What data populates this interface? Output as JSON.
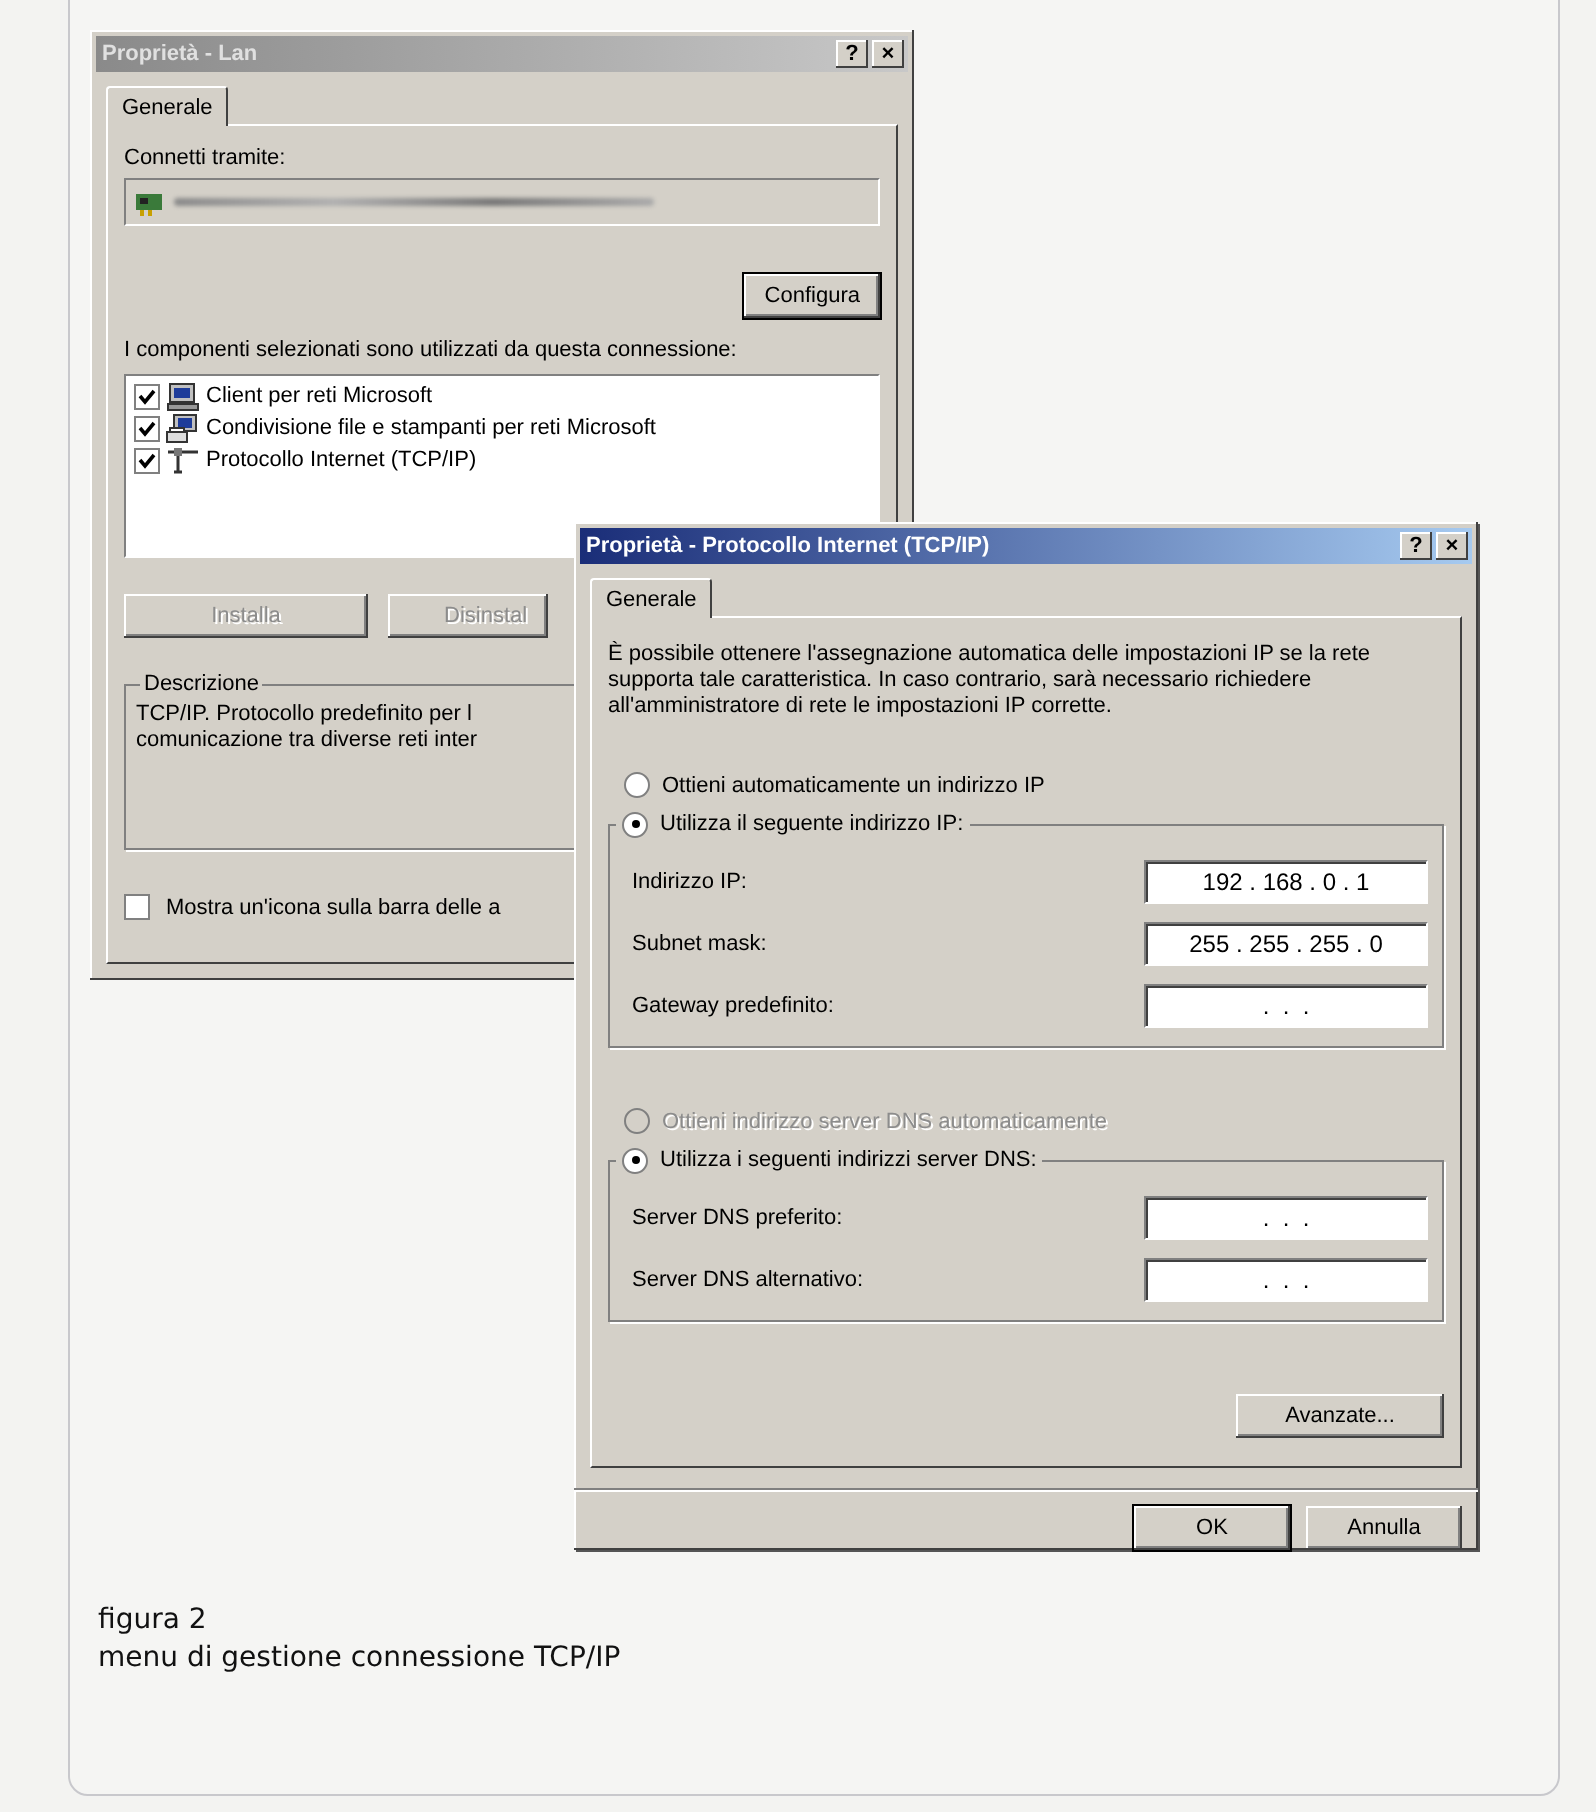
{
  "lan_dialog": {
    "title": "Proprietà - Lan",
    "active": false,
    "help_button": "?",
    "close_button": "×",
    "tabs": [
      {
        "label": "Generale",
        "selected": true
      }
    ],
    "connect_label": "Connetti tramite:",
    "configure_button": "Configura",
    "components_label": "I componenti selezionati sono utilizzati da questa connessione:",
    "components": [
      {
        "kind": "client",
        "label": "Client per reti Microsoft",
        "checked": true
      },
      {
        "kind": "share",
        "label": "Condivisione file e stampanti per reti Microsoft",
        "checked": true
      },
      {
        "kind": "protocol",
        "label": "Protocollo Internet (TCP/IP)",
        "checked": true
      }
    ],
    "buttons": [
      {
        "label": "Installa",
        "disabled": true
      },
      {
        "label": "Disinstal",
        "disabled": true
      }
    ],
    "description": {
      "title": "Descrizione",
      "lines": [
        "TCP/IP. Protocollo predefinito per l",
        "comunicazione tra diverse reti inter"
      ]
    },
    "tray_checkbox": {
      "label": "Mostra un'icona sulla barra delle a",
      "checked": false
    }
  },
  "tcpip_dialog": {
    "title": "Proprietà - Protocollo Internet (TCP/IP)",
    "active": true,
    "help_button": "?",
    "close_button": "×",
    "tabs": [
      {
        "label": "Generale",
        "selected": true
      }
    ],
    "intro": "È possibile ottenere l'assegnazione automatica delle impostazioni IP se la rete supporta tale caratteristica. In caso contrario, sarà necessario richiedere all'amministratore di rete le impostazioni IP corrette.",
    "ip_options": [
      {
        "label": "Ottieni automaticamente un indirizzo IP",
        "selected": false,
        "disabled": false
      },
      {
        "label": "Utilizza il seguente indirizzo IP:",
        "selected": true,
        "disabled": false
      }
    ],
    "ip_fields": [
      {
        "label": "Indirizzo IP:",
        "value": "192 . 168 . 0 . 1"
      },
      {
        "label": "Subnet mask:",
        "value": "255 . 255 . 255 . 0"
      },
      {
        "label": "Gateway predefinito:",
        "value": ".  .  ."
      }
    ],
    "dns_options": [
      {
        "label": "Ottieni indirizzo server DNS automaticamente",
        "selected": false,
        "disabled": true
      },
      {
        "label": "Utilizza i seguenti indirizzi server DNS:",
        "selected": true,
        "disabled": false
      }
    ],
    "dns_fields": [
      {
        "label": "Server DNS preferito:",
        "value": ".  .  ."
      },
      {
        "label": "Server DNS alternativo:",
        "value": ".  .  ."
      }
    ],
    "advanced_button": "Avanzate...",
    "ok_button": "OK",
    "cancel_button": "Annulla"
  },
  "caption": {
    "number": "figura 2",
    "text": "menu di gestione connessione TCP/IP"
  }
}
